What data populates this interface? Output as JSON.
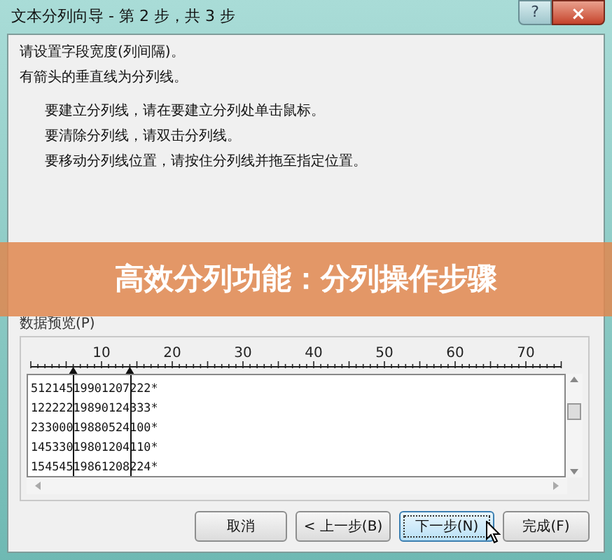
{
  "window": {
    "title": "文本分列向导 - 第 2 步，共 3 步",
    "help": "?",
    "close": "×"
  },
  "intro": [
    "请设置字段宽度(列间隔)。",
    "有箭头的垂直线为分列线。"
  ],
  "instructions": [
    "要建立分列线，请在要建立分列处单击鼠标。",
    "要清除分列线，请双击分列线。",
    "要移动分列线位置，请按住分列线并拖至指定位置。"
  ],
  "banner": "高效分列功能：分列操作步骤",
  "preview": {
    "label": "数据预览(P)",
    "ruler_labels": [
      "10",
      "20",
      "30",
      "40",
      "50",
      "60",
      "70"
    ],
    "rows": [
      [
        "512145",
        "19901207",
        "222*"
      ],
      [
        "122222",
        "19890124",
        "333*"
      ],
      [
        "233000",
        "19880524",
        "100*"
      ],
      [
        "145330",
        "19801204",
        "110*"
      ],
      [
        "154545",
        "19861208",
        "224*"
      ]
    ]
  },
  "buttons": [
    {
      "label": "取消",
      "focused": false
    },
    {
      "label": "< 上一步(B)",
      "focused": false
    },
    {
      "label": "下一步(N)",
      "focused": true
    },
    {
      "label": "完成(F)",
      "focused": false
    }
  ]
}
